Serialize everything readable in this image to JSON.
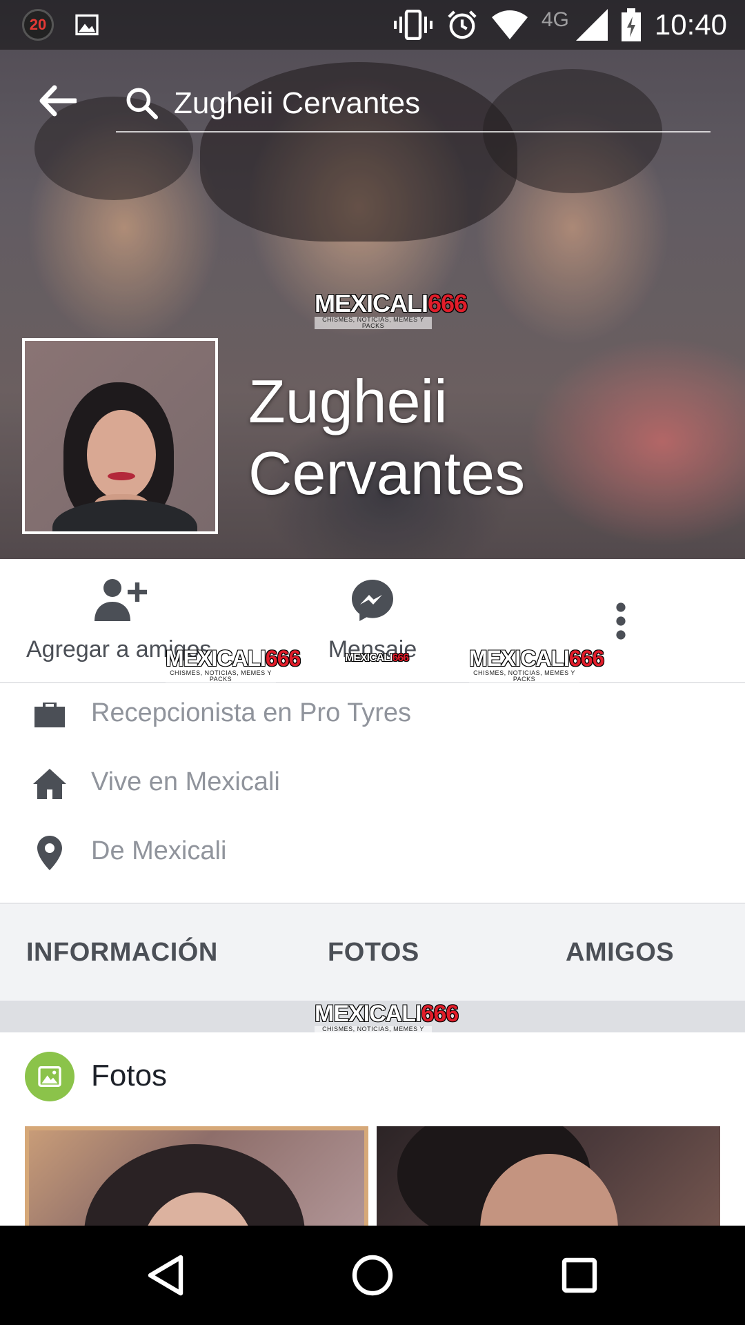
{
  "status_bar": {
    "notification_count": "20",
    "network_type": "4G",
    "time": "10:40",
    "icons": [
      "notification-badge",
      "gallery-icon",
      "vibrate-icon",
      "alarm-icon",
      "wifi-icon",
      "signal-icon",
      "battery-charging-icon"
    ]
  },
  "search": {
    "value": "Zugheii Cervantes"
  },
  "watermark": {
    "brand": "MEXICALI",
    "number": "666",
    "tagline": "CHISMES, NOTICIAS, MEMES Y PACKS"
  },
  "profile": {
    "name_line1": "Zugheii",
    "name_line2": "Cervantes"
  },
  "actions": {
    "add_friend": "Agregar a amigos",
    "message": "Mensaje",
    "more_icon": "more-vertical-icon"
  },
  "about": {
    "work": "Recepcionista en Pro Tyres",
    "lives": "Vive en Mexicali",
    "from": "De Mexicali"
  },
  "tabs": {
    "info": "INFORMACIÓN",
    "photos": "FOTOS",
    "friends": "AMIGOS"
  },
  "photos_section": {
    "title": "Fotos",
    "icon_color": "#8bc34a"
  },
  "colors": {
    "accent_messenger": "#4b4f56",
    "secondary_text": "#90949c",
    "tab_background": "#f2f3f5"
  }
}
